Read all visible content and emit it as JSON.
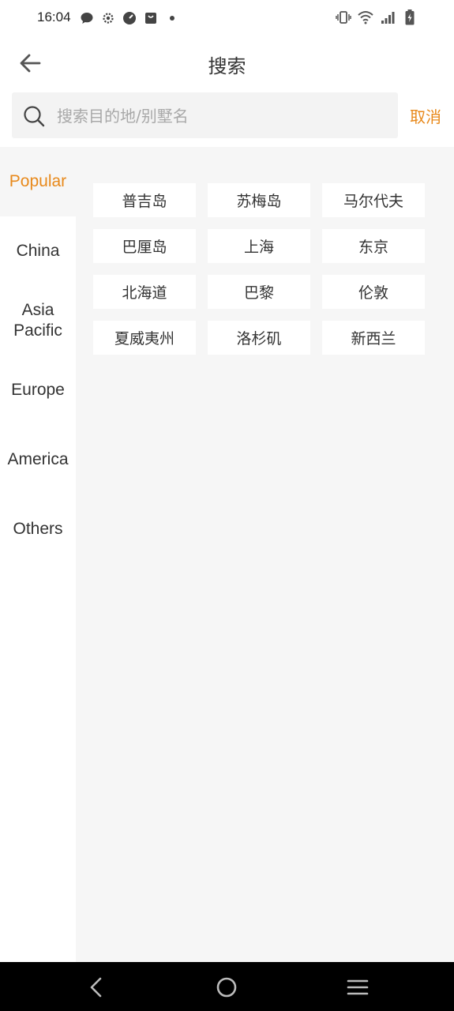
{
  "status": {
    "time": "16:04"
  },
  "header": {
    "title": "搜索"
  },
  "search": {
    "placeholder": "搜索目的地/别墅名",
    "cancel": "取消"
  },
  "sidebar": {
    "items": [
      {
        "label": "Popular",
        "active": true
      },
      {
        "label": "China"
      },
      {
        "label": "Asia\nPacific"
      },
      {
        "label": "Europe"
      },
      {
        "label": "America"
      },
      {
        "label": "Others"
      }
    ]
  },
  "cities": [
    "普吉岛",
    "苏梅岛",
    "马尔代夫",
    "巴厘岛",
    "上海",
    "东京",
    "北海道",
    "巴黎",
    "伦敦",
    "夏威夷州",
    "洛杉矶",
    "新西兰"
  ],
  "colors": {
    "accent": "#e8891b",
    "panel": "#f6f6f6"
  }
}
